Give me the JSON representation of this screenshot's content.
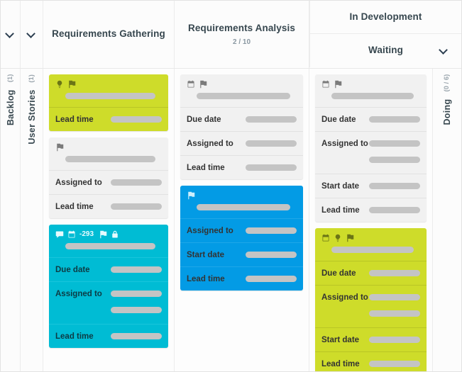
{
  "board": {
    "headers": {
      "collapse_icon_1": "chevron-down-icon",
      "collapse_icon_2": "chevron-down-icon",
      "column_1_title": "Requirements Gathering",
      "column_2_title": "Requirements Analysis",
      "column_2_count": "2 / 10",
      "parent_title": "In Development",
      "sub_title": "Waiting",
      "sub_collapse_icon": "chevron-down-icon"
    },
    "swimlanes": [
      {
        "name": "Backlog",
        "count": "(1)"
      },
      {
        "name": "User Stories",
        "count": "(1)"
      }
    ],
    "right_lane": {
      "name": "Doing",
      "count": "(0 / 6)"
    },
    "labels": {
      "due_date": "Due date",
      "assigned_to": "Assigned to",
      "start_date": "Start date",
      "lead_time": "Lead time"
    },
    "colors": {
      "lime": "#cedc2a",
      "cyan": "#00bcd4",
      "blue": "#039be5",
      "white": "#f1f1f1",
      "bar": "#c4c4c4",
      "text": "#37474f"
    },
    "columns": [
      {
        "id": "requirements-gathering",
        "cards": [
          {
            "theme": "lime",
            "icons": [
              "lightbulb-icon",
              "flag-icon"
            ],
            "badge": "",
            "rows": [
              {
                "label": "Lead time",
                "value_width": 72
              }
            ]
          },
          {
            "theme": "white",
            "icons": [
              "flag-icon"
            ],
            "badge": "",
            "rows": [
              {
                "label": "Assigned to",
                "value_width": 72
              },
              {
                "label": "Lead time",
                "value_width": 72
              }
            ]
          },
          {
            "theme": "cyan",
            "icons": [
              "comment-icon",
              "calendar-icon",
              "flag-icon",
              "lock-icon"
            ],
            "badge": "-293",
            "rows": [
              {
                "label": "Due date",
                "value_width": 72
              },
              {
                "label": "Assigned to",
                "value_width": 72,
                "extra_value_width": 72
              },
              {
                "label": "Lead time",
                "value_width": 72
              }
            ]
          }
        ]
      },
      {
        "id": "requirements-analysis",
        "cards": [
          {
            "theme": "white",
            "icons": [
              "calendar-icon",
              "flag-icon"
            ],
            "badge": "",
            "rows": [
              {
                "label": "Due date",
                "value_width": 72
              },
              {
                "label": "Assigned to",
                "value_width": 72
              },
              {
                "label": "Lead time",
                "value_width": 72
              }
            ]
          },
          {
            "theme": "blue",
            "icons": [
              "flag-icon"
            ],
            "badge": "",
            "rows": [
              {
                "label": "Assigned to",
                "value_width": 72
              },
              {
                "label": "Start date",
                "value_width": 72
              },
              {
                "label": "Lead time",
                "value_width": 72
              }
            ]
          }
        ]
      },
      {
        "id": "waiting",
        "cards": [
          {
            "theme": "white",
            "icons": [
              "calendar-icon",
              "flag-icon"
            ],
            "badge": "",
            "rows": [
              {
                "label": "Due date",
                "value_width": 72
              },
              {
                "label": "Assigned to",
                "value_width": 72,
                "extra_value_width": 72
              },
              {
                "label": "Start date",
                "value_width": 72
              },
              {
                "label": "Lead time",
                "value_width": 72
              }
            ]
          },
          {
            "theme": "lime",
            "icons": [
              "calendar-icon",
              "lightbulb-icon",
              "flag-icon"
            ],
            "badge": "",
            "rows": [
              {
                "label": "Due date",
                "value_width": 72
              },
              {
                "label": "Assigned to",
                "value_width": 72,
                "extra_value_width": 72
              },
              {
                "label": "Start date",
                "value_width": 72
              },
              {
                "label": "Lead time",
                "value_width": 72
              }
            ]
          }
        ]
      }
    ]
  }
}
